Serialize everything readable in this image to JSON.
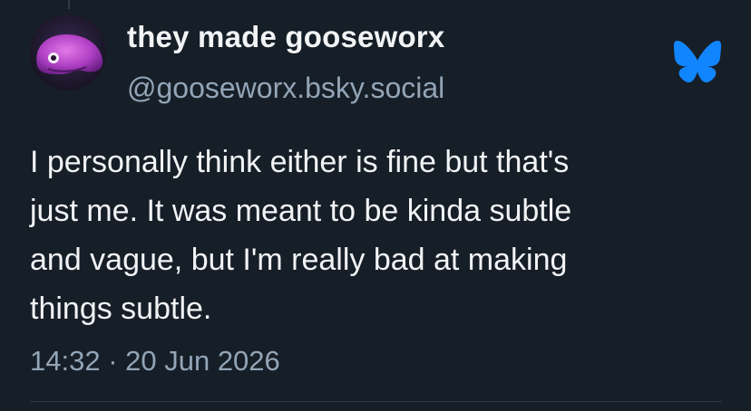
{
  "post": {
    "display_name": "they made gooseworx",
    "handle": "@gooseworx.bsky.social",
    "text_lines": [
      "I personally think either is fine but that's",
      "just me. It was meant to be kinda subtle",
      "and vague, but I'm really bad at making",
      "things subtle."
    ],
    "timestamp": "14:32 · 20 Jun 2026"
  },
  "icons": {
    "avatar": "avatar",
    "brand": "bluesky-butterfly-icon"
  },
  "colors": {
    "background": "#161e27",
    "primary_text": "#f1f3f5",
    "secondary_text": "#93a5b7",
    "brand_blue": "#1185fe",
    "divider": "#2e3b4a"
  }
}
